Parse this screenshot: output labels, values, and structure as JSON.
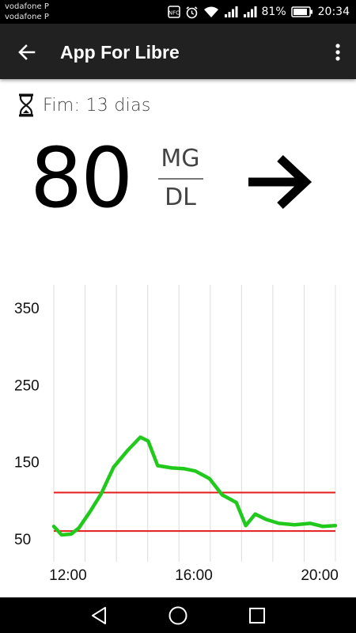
{
  "status_bar": {
    "carrier_1": "vodafone P",
    "carrier_2": "vodafone P",
    "icons": [
      "nfc-icon",
      "alarm-icon",
      "wifi-icon",
      "signal-icon",
      "signal-icon",
      "battery-icon"
    ],
    "battery_percent": "81%",
    "time": "20:34"
  },
  "app_bar": {
    "title": "App For Libre",
    "back_icon": "arrow-back-icon",
    "menu_icon": "more-vert-icon",
    "background": "#212121"
  },
  "sensor": {
    "icon": "hourglass-icon",
    "text": "Fim: 13 dias"
  },
  "reading": {
    "value": "80",
    "unit_top": "MG",
    "unit_bottom": "DL",
    "trend_icon": "arrow-right-icon"
  },
  "chart_data": {
    "type": "line",
    "x_ticks": [
      "12:00",
      "16:00",
      "20:00"
    ],
    "y_ticks": [
      "350",
      "250",
      "150",
      "50"
    ],
    "ylim": [
      20,
      380
    ],
    "xlim": [
      11.55,
      20.5
    ],
    "grid": "vertical",
    "series": [
      {
        "color": "#22c91d",
        "x": [
          11.55,
          11.8,
          12.1,
          12.35,
          12.7,
          13.05,
          13.45,
          13.9,
          14.3,
          14.55,
          14.85,
          15.3,
          15.7,
          16.05,
          16.5,
          16.9,
          17.35,
          17.65,
          17.95,
          18.3,
          18.7,
          19.2,
          19.7,
          20.1,
          20.5
        ],
        "y": [
          66,
          55,
          56,
          64,
          85,
          108,
          143,
          165,
          182,
          177,
          145,
          142,
          141,
          138,
          128,
          107,
          97,
          67,
          82,
          75,
          70,
          68,
          70,
          66,
          67
        ]
      }
    ],
    "target_range": {
      "low": 60,
      "high": 110,
      "color": "#e41b1b"
    }
  },
  "nav_bar": {
    "buttons": [
      "nav-back-icon",
      "nav-home-icon",
      "nav-recents-icon"
    ]
  }
}
